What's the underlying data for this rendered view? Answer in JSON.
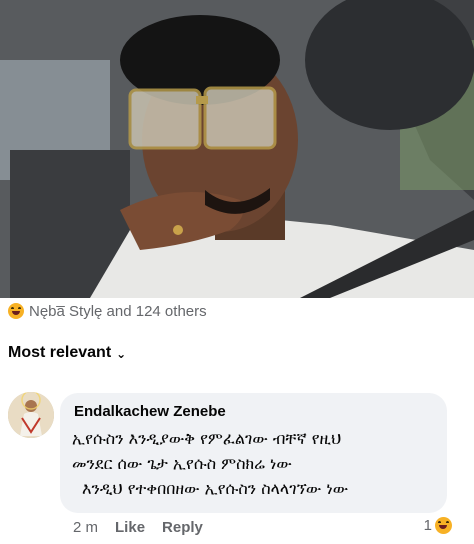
{
  "post": {
    "photo_alt": "selfie"
  },
  "reactions": {
    "summary": "Nęba̅ Stylę and 124 others",
    "icon": "haha-reaction-icon"
  },
  "comments_sort": {
    "label": "Most relevant",
    "chevron": "⌄"
  },
  "comment": {
    "author": "Endalkachew Zenebe",
    "lines": [
      "ኢየሱስን እንዲያውቅ የምፈልገው ብቸኛ የዚህ",
      "መንደር ሰው  ጌታ ኢየሱስ ምስክሬ ነው",
      "እንዲህ የተቀበበዘው ኢየሱስን ስላላገኘው ነው"
    ],
    "time": "2 m",
    "like_label": "Like",
    "reply_label": "Reply",
    "reaction_count": "1"
  },
  "colors": {
    "secondary_text": "#65676b",
    "bubble_bg": "#f0f2f5",
    "haha_yellow": "#f7b125"
  }
}
